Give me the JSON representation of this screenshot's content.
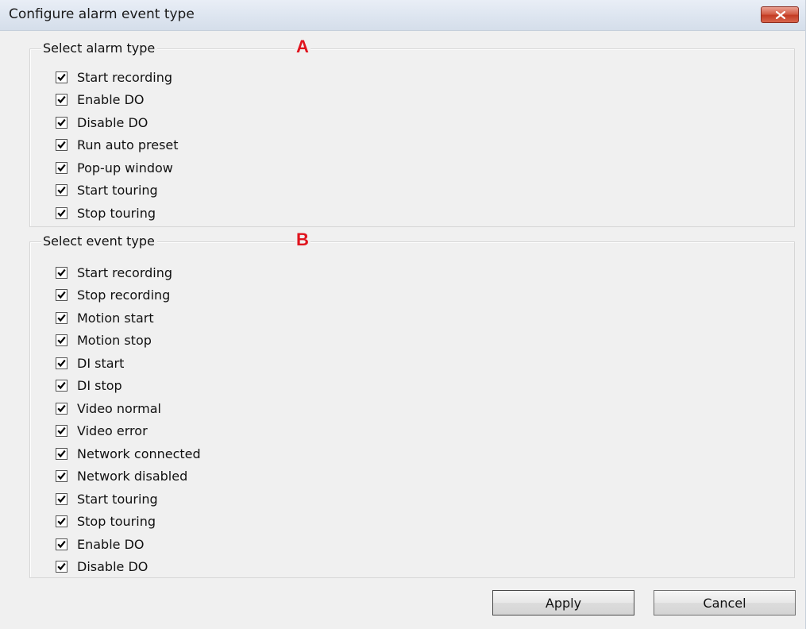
{
  "window": {
    "title": "Configure alarm event type",
    "close_icon": "close-icon"
  },
  "alarm_group": {
    "legend": "Select alarm type",
    "marker": "A",
    "items": [
      {
        "label": "Start recording",
        "checked": true
      },
      {
        "label": "Enable DO",
        "checked": true
      },
      {
        "label": "Disable DO",
        "checked": true
      },
      {
        "label": "Run auto preset",
        "checked": true
      },
      {
        "label": "Pop-up window",
        "checked": true
      },
      {
        "label": "Start touring",
        "checked": true
      },
      {
        "label": "Stop touring",
        "checked": true
      }
    ]
  },
  "event_group": {
    "legend": "Select event type",
    "marker": "B",
    "items": [
      {
        "label": "Start recording",
        "checked": true
      },
      {
        "label": "Stop recording",
        "checked": true
      },
      {
        "label": "Motion start",
        "checked": true
      },
      {
        "label": "Motion stop",
        "checked": true
      },
      {
        "label": "DI start",
        "checked": true
      },
      {
        "label": "DI stop",
        "checked": true
      },
      {
        "label": "Video normal",
        "checked": true
      },
      {
        "label": "Video error",
        "checked": true
      },
      {
        "label": "Network connected",
        "checked": true
      },
      {
        "label": "Network disabled",
        "checked": true
      },
      {
        "label": "Start touring",
        "checked": true
      },
      {
        "label": "Stop touring",
        "checked": true
      },
      {
        "label": "Enable DO",
        "checked": true
      },
      {
        "label": "Disable DO",
        "checked": true
      }
    ]
  },
  "buttons": {
    "apply": "Apply",
    "cancel": "Cancel"
  },
  "colors": {
    "marker": "#e0141e",
    "close_button": "#c23a22"
  }
}
